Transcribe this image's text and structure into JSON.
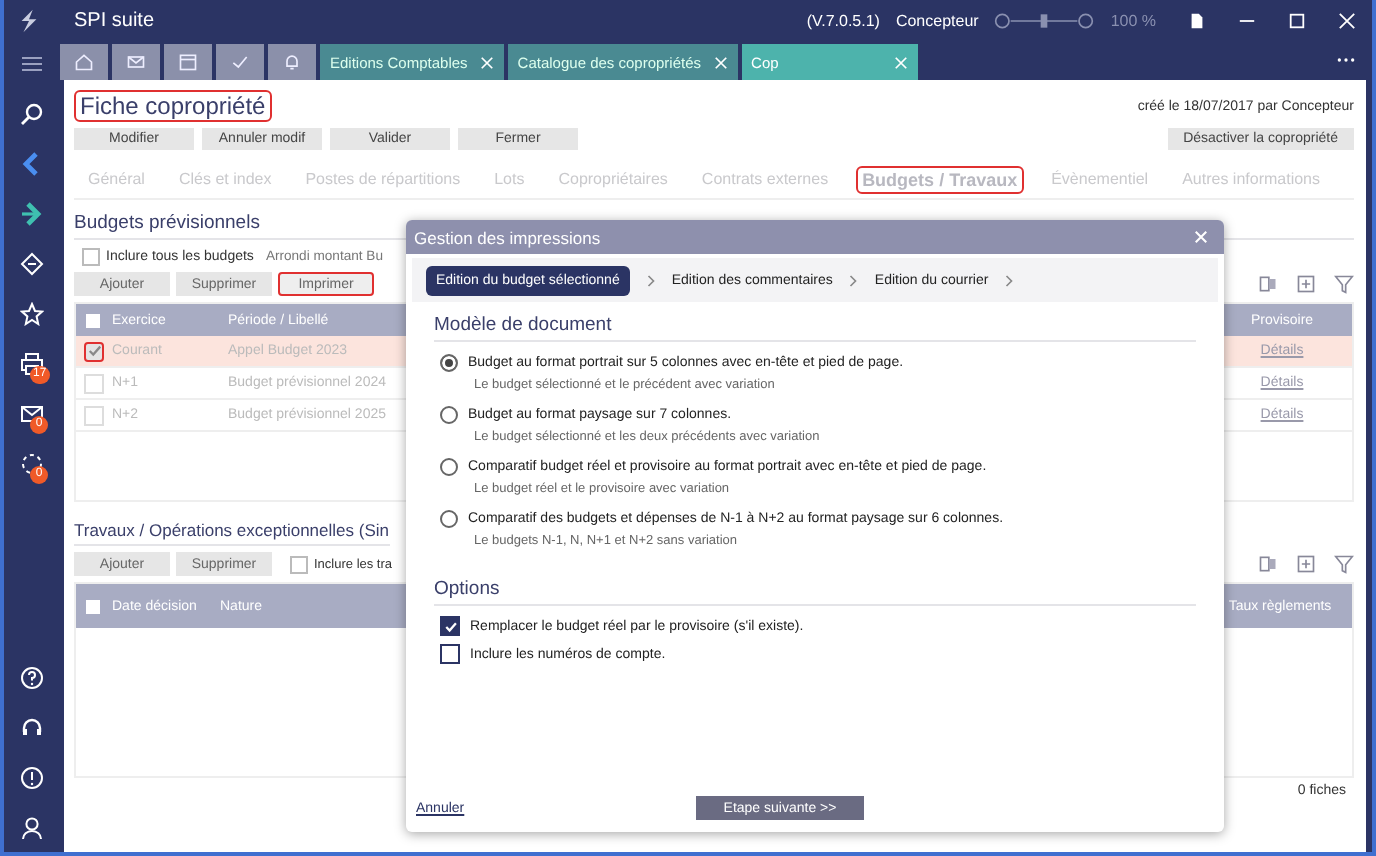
{
  "app": {
    "title": "SPI suite",
    "version": "(V.7.0.5.1)",
    "user": "Concepteur",
    "zoom": "100 %",
    "level": 0.5
  },
  "doc_tabs": [
    {
      "label": "Editions Comptables",
      "selected": false
    },
    {
      "label": "Catalogue des copropriétés",
      "selected": false
    },
    {
      "label": "Cop",
      "selected": true
    }
  ],
  "sidebar_badges": [
    "17",
    "0",
    "0"
  ],
  "page": {
    "title": "Fiche copropriété",
    "title_highlighted": true,
    "created": "créé le 18/07/2017 par Concepteur",
    "actions": [
      "Modifier",
      "Annuler modif",
      "Valider",
      "Fermer"
    ],
    "deactivate": "Désactiver la copropriété",
    "tabs": [
      {
        "label": "Général",
        "selected": false,
        "highlighted": false
      },
      {
        "label": "Clés et index",
        "selected": false,
        "highlighted": false
      },
      {
        "label": "Postes de répartitions",
        "selected": false,
        "highlighted": false
      },
      {
        "label": "Lots",
        "selected": false,
        "highlighted": false
      },
      {
        "label": "Copropriétaires",
        "selected": false,
        "highlighted": false
      },
      {
        "label": "Contrats externes",
        "selected": false,
        "highlighted": false
      },
      {
        "label": "Budgets / Travaux",
        "selected": true,
        "highlighted": true
      },
      {
        "label": "Évènementiel",
        "selected": false,
        "highlighted": false
      },
      {
        "label": "Autres informations",
        "selected": false,
        "highlighted": false
      }
    ]
  },
  "budgets": {
    "title": "Budgets prévisionnels",
    "include_all": {
      "label": "Inclure tous les budgets",
      "checked": false
    },
    "rounding_label": "Arrondi montant Bu",
    "buttons": [
      {
        "label": "Ajouter",
        "highlighted": false
      },
      {
        "label": "Supprimer",
        "highlighted": false
      },
      {
        "label": "Imprimer",
        "highlighted": true
      }
    ],
    "columns": [
      "Exercice",
      "Période / Libellé",
      "Provisoire"
    ],
    "select_all_checked": false,
    "rows": [
      {
        "exercice": "Courant",
        "label": "Appel Budget 2023",
        "link": "Détails",
        "selected": true,
        "checked": true,
        "highlighted": true
      },
      {
        "exercice": "N+1",
        "label": "Budget prévisionnel 2024",
        "link": "Détails",
        "selected": false,
        "checked": false,
        "highlighted": false
      },
      {
        "exercice": "N+2",
        "label": "Budget prévisionnel 2025",
        "link": "Détails",
        "selected": false,
        "checked": false,
        "highlighted": false
      }
    ]
  },
  "travaux": {
    "title": "Travaux / Opérations exceptionnelles (Sin",
    "buttons": [
      "Ajouter",
      "Supprimer"
    ],
    "include": {
      "label": "Inclure les tra",
      "checked": false
    },
    "columns": [
      "Date décision",
      "Nature",
      "Taux règlements"
    ],
    "select_all_checked": false,
    "count": "0 fiches"
  },
  "dialog": {
    "title": "Gestion des impressions",
    "steps": [
      {
        "label": "Edition du budget sélectionné",
        "selected": true
      },
      {
        "label": "Edition des commentaires",
        "selected": false
      },
      {
        "label": "Edition du courrier",
        "selected": false
      }
    ],
    "model_title": "Modèle de document",
    "models": [
      {
        "label": "Budget au format portrait sur 5 colonnes avec en-tête et pied de page.",
        "description": "Le budget sélectionné et le précédent avec variation",
        "selected": true
      },
      {
        "label": "Budget au format paysage sur 7 colonnes.",
        "description": "Le budget sélectionné et les deux précédents avec variation",
        "selected": false
      },
      {
        "label": "Comparatif budget réel et provisoire au format portrait avec en-tête et pied de page.",
        "description": "Le budget réel et le provisoire avec variation",
        "selected": false
      },
      {
        "label": "Comparatif des budgets et dépenses de N-1 à N+2 au format paysage sur 6 colonnes.",
        "description": "Le budgets N-1, N, N+1 et N+2 sans variation",
        "selected": false
      }
    ],
    "options_title": "Options",
    "options": [
      {
        "label": "Remplacer le budget réel par le provisoire (s'il existe).",
        "checked": true
      },
      {
        "label": "Inclure les numéros de compte.",
        "checked": false
      }
    ],
    "cancel": "Annuler",
    "next": "Etape suivante >>"
  }
}
